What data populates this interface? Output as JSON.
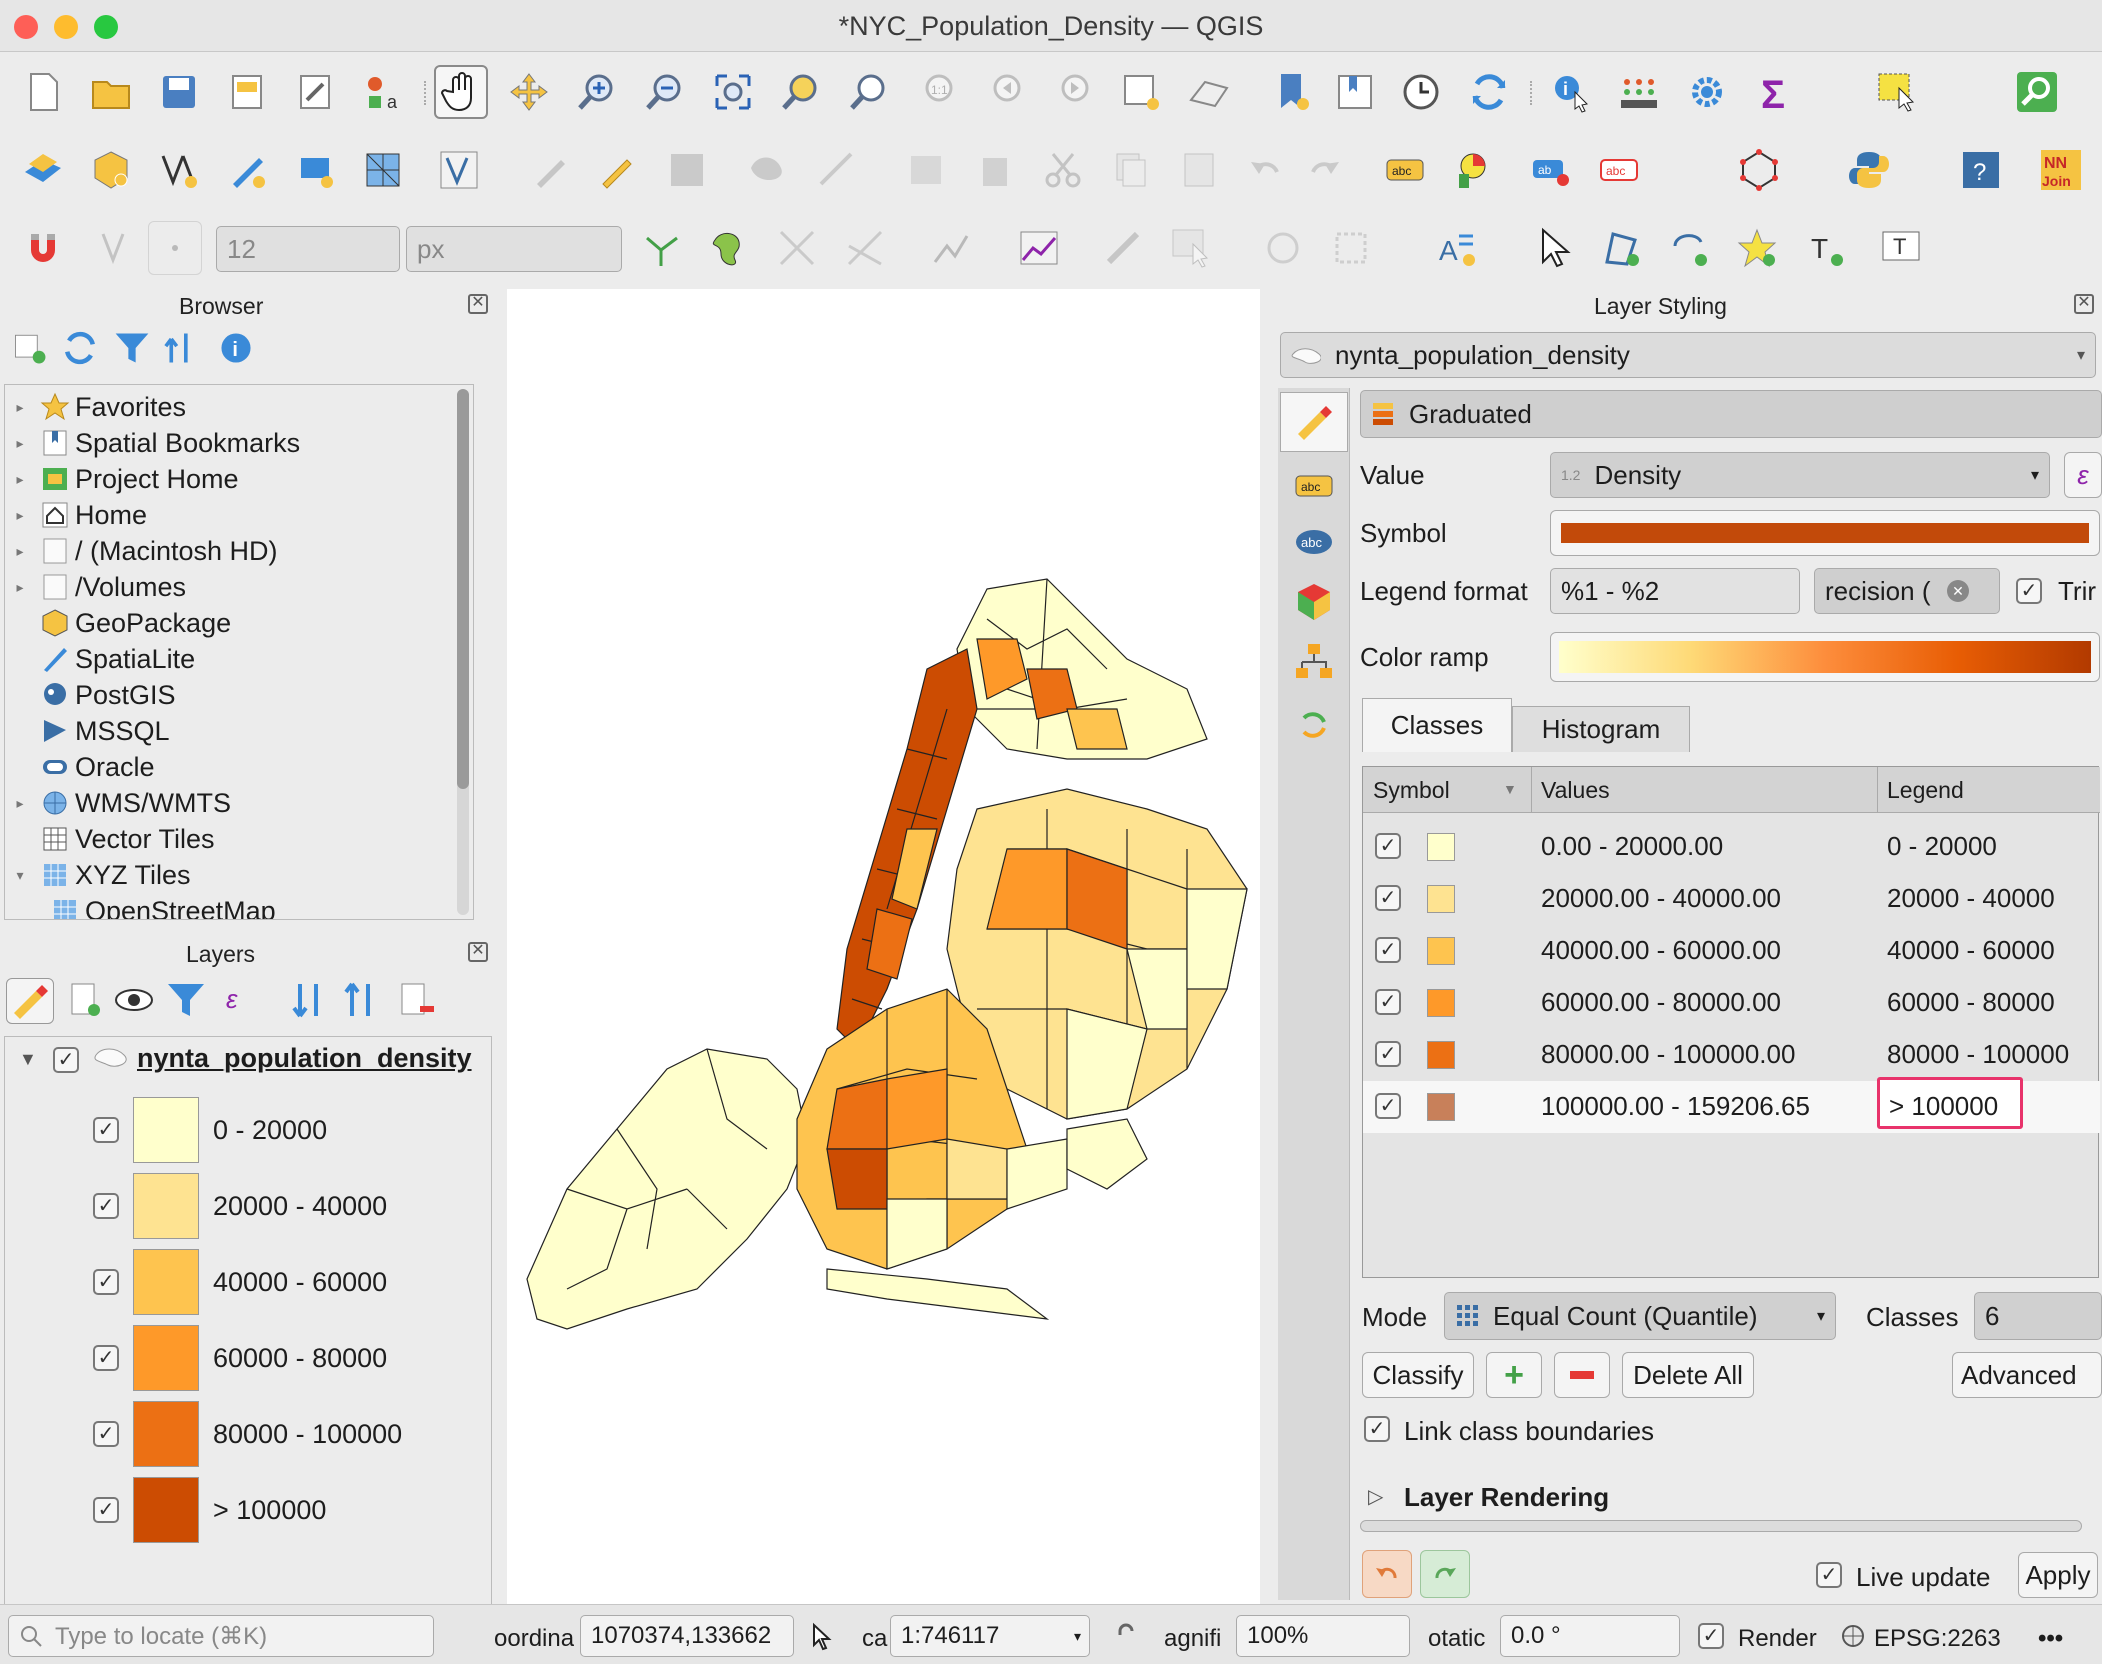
{
  "window": {
    "title": "*NYC_Population_Density — QGIS"
  },
  "toolbar": {
    "row3": {
      "size_value": "12",
      "unit_value": "px"
    }
  },
  "browser": {
    "title": "Browser",
    "items": [
      {
        "label": "Favorites",
        "icon": "star-icon"
      },
      {
        "label": "Spatial Bookmarks",
        "icon": "bookmark-icon"
      },
      {
        "label": "Project Home",
        "icon": "project-home-icon"
      },
      {
        "label": "Home",
        "icon": "home-icon"
      },
      {
        "label": "/ (Macintosh HD)",
        "icon": "folder-icon"
      },
      {
        "label": "/Volumes",
        "icon": "folder-icon"
      },
      {
        "label": "GeoPackage",
        "icon": "geopackage-icon"
      },
      {
        "label": "SpatiaLite",
        "icon": "spatialite-icon"
      },
      {
        "label": "PostGIS",
        "icon": "postgis-icon"
      },
      {
        "label": "MSSQL",
        "icon": "mssql-icon"
      },
      {
        "label": "Oracle",
        "icon": "oracle-icon"
      },
      {
        "label": "WMS/WMTS",
        "icon": "globe-icon"
      },
      {
        "label": "Vector Tiles",
        "icon": "grid-icon"
      },
      {
        "label": "XYZ Tiles",
        "icon": "grid-icon"
      },
      {
        "label": "OpenStreetMap",
        "icon": "grid-icon"
      }
    ]
  },
  "layers": {
    "title": "Layers",
    "layer_name": "nynta_population_density",
    "classes": [
      {
        "label": "0 - 20000",
        "color": "#ffffcc"
      },
      {
        "label": "20000 - 40000",
        "color": "#fee391"
      },
      {
        "label": "40000 - 60000",
        "color": "#fec44f"
      },
      {
        "label": "60000 - 80000",
        "color": "#fe9929"
      },
      {
        "label": "80000 - 100000",
        "color": "#ec7014"
      },
      {
        "label": "> 100000",
        "color": "#cc4c02"
      }
    ]
  },
  "styling": {
    "title": "Layer Styling",
    "layer_select": "nynta_population_density",
    "renderer": "Graduated",
    "value_label": "Value",
    "value_field": "Density",
    "symbol_label": "Symbol",
    "legend_format_label": "Legend format",
    "legend_format": "%1 - %2",
    "precision_text": "recision (",
    "trim_label": "Trir",
    "color_ramp_label": "Color ramp",
    "tabs": [
      "Classes",
      "Histogram"
    ],
    "table_headers": [
      "Symbol",
      "Values",
      "Legend"
    ],
    "rows": [
      {
        "values": "0.00 - 20000.00",
        "legend": "0 - 20000",
        "color": "#ffffcc"
      },
      {
        "values": "20000.00 - 40000.00",
        "legend": "20000 - 40000",
        "color": "#fee391"
      },
      {
        "values": "40000.00 - 60000.00",
        "legend": "40000 - 60000",
        "color": "#fec44f"
      },
      {
        "values": "60000.00 - 80000.00",
        "legend": "60000 - 80000",
        "color": "#fe9929"
      },
      {
        "values": "80000.00 - 100000.00",
        "legend": "80000 - 100000",
        "color": "#ec7014"
      },
      {
        "values": "100000.00 - 159206.65",
        "legend": "> 100000",
        "color": "#c8805a"
      }
    ],
    "mode_label": "Mode",
    "mode_value": "Equal Count (Quantile)",
    "classes_label": "Classes",
    "classes_value": "6",
    "classify_btn": "Classify",
    "delete_all_btn": "Delete All",
    "advanced_btn": "Advanced",
    "link_boundaries": "Link class boundaries",
    "layer_rendering": "Layer Rendering",
    "live_update": "Live update",
    "apply_btn": "Apply"
  },
  "status": {
    "locate_placeholder": "Type to locate (⌘K)",
    "coord_label": "oordina",
    "coord_value": "1070374,133662",
    "scale_label": "ca",
    "scale_value": "1:746117",
    "magnifier_label": "agnifi",
    "magnifier_value": "100%",
    "rotation_label": "otatic",
    "rotation_value": "0.0 °",
    "render_label": "Render",
    "crs": "EPSG:2263"
  },
  "colors": {
    "highlight": "#e8336b",
    "symbol_bar": "#c24a0a"
  }
}
